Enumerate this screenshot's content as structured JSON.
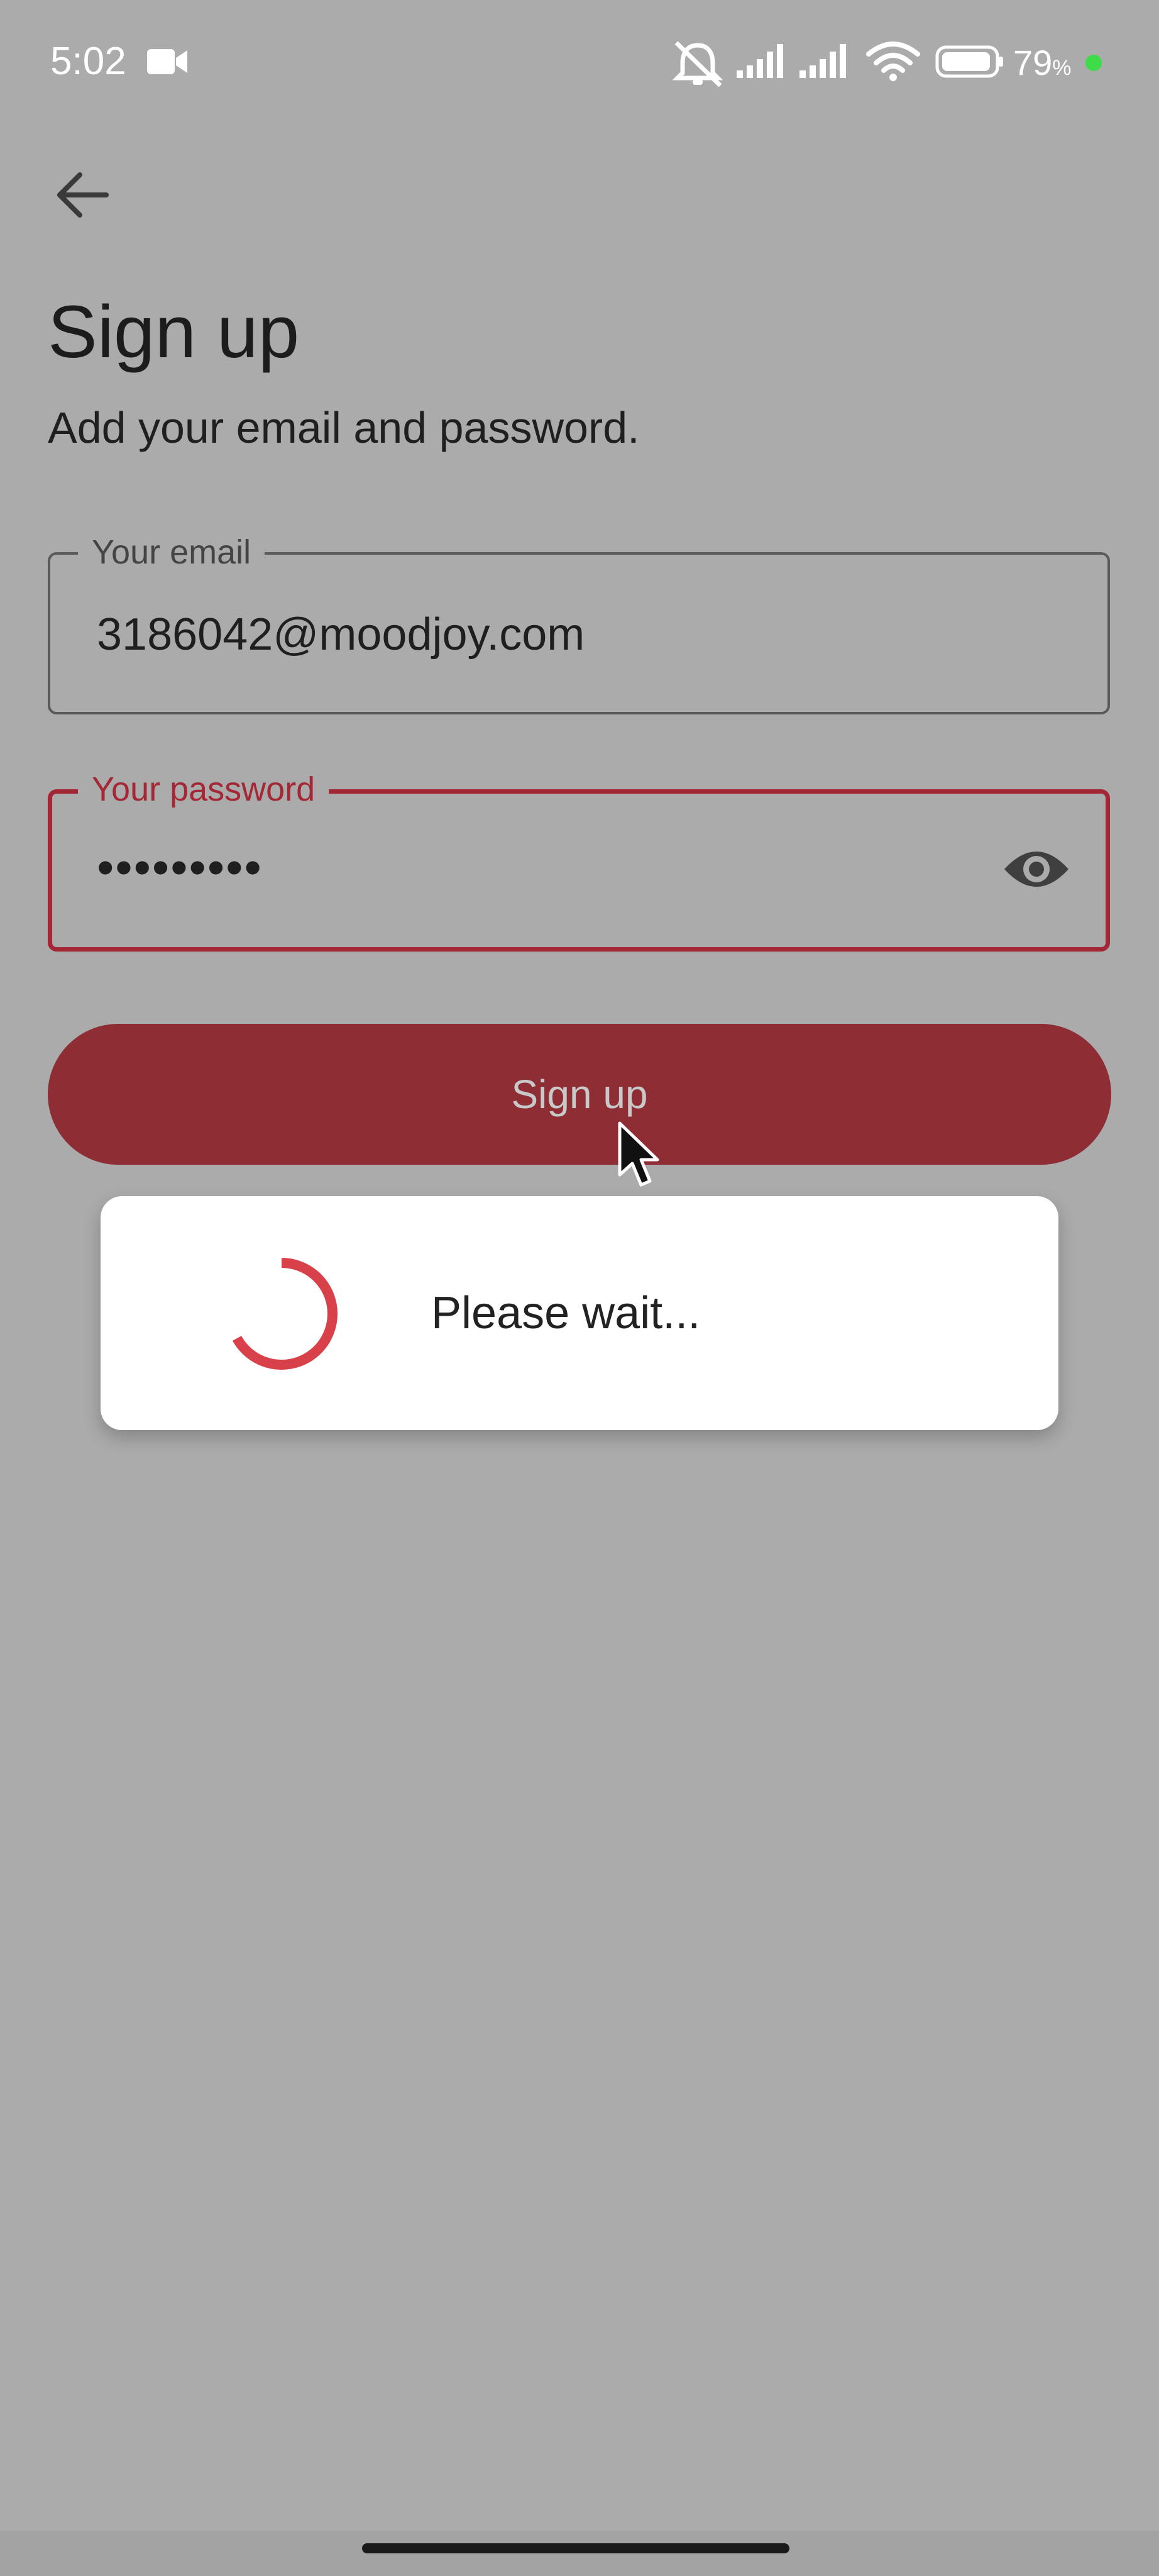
{
  "status_bar": {
    "time": "5:02",
    "battery_percent": "79",
    "battery_unit": "%",
    "icons": [
      "video-camera-icon",
      "alarm-off-icon",
      "signal-icon",
      "signal-icon",
      "wifi-icon",
      "battery-icon",
      "charging-dot-icon"
    ]
  },
  "header": {
    "back_icon": "arrow-back-icon",
    "title": "Sign up",
    "subtitle": "Add your email and password."
  },
  "form": {
    "email": {
      "label": "Your email",
      "value": "3186042@moodjoy.com"
    },
    "password": {
      "label": "Your password",
      "value": "•••••••••",
      "toggle_icon": "eye-icon"
    },
    "submit_label": "Sign up"
  },
  "dialog": {
    "message": "Please wait..."
  },
  "colors": {
    "accent": "#a32734",
    "button": "#8f2d35",
    "spinner": "#d8414a",
    "scrim_background": "#ababab"
  }
}
